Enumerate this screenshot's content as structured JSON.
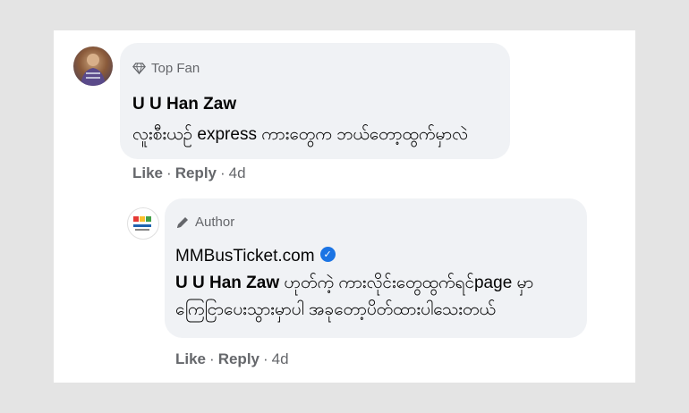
{
  "comment": {
    "badge_label": "Top Fan",
    "badge_icon": "diamond-icon",
    "author": "U U Han Zaw",
    "text": "လူးစီးယဥ် express ကားတွေက ဘယ်တော့ထွက်မှာလဲ",
    "actions": {
      "like": "Like",
      "reply": "Reply",
      "time": "4d"
    }
  },
  "reply": {
    "badge_label": "Author",
    "badge_icon": "pencil-icon",
    "author": "MMBusTicket.com",
    "verified": true,
    "mention": "U U Han Zaw",
    "text_line1": " ဟုတ်ကဲ့ ကားလိုင်းတွေထွက်ရင်page မှာ",
    "text_line2": "ကြေငြာပေးသွားမှာပါ အခုတော့ပိတ်ထားပါသေးတယ်",
    "actions": {
      "like": "Like",
      "reply": "Reply",
      "time": "4d"
    }
  },
  "colors": {
    "bubble": "#f0f2f5",
    "secondary_text": "#65676b",
    "verified_blue": "#1b74e4"
  }
}
